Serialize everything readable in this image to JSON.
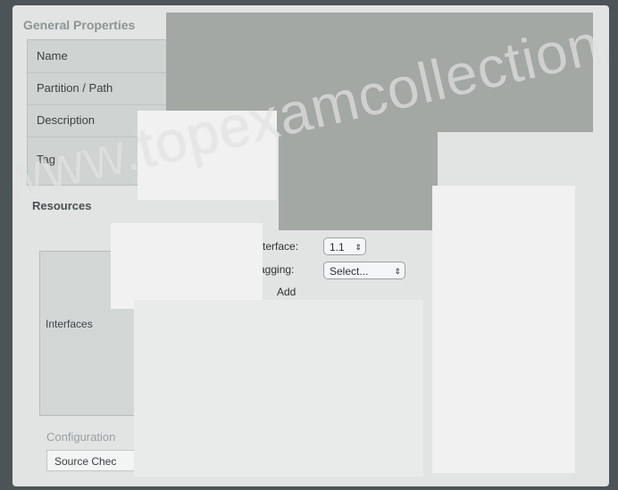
{
  "general": {
    "title": "General Properties",
    "rows": [
      "Name",
      "Partition / Path",
      "Description",
      "Tag"
    ]
  },
  "resources": {
    "title": "Resources"
  },
  "interfaces": {
    "label": "Interfaces"
  },
  "controls": {
    "interface_label": "Interface:",
    "interface_value": "1.1",
    "tagging_label": "Tagging:",
    "tagging_value": "Select...",
    "add_label": "Add"
  },
  "configuration": {
    "title": "Configuration",
    "field_label": "Source Chec"
  },
  "watermark": "www.topexamcollection.com"
}
